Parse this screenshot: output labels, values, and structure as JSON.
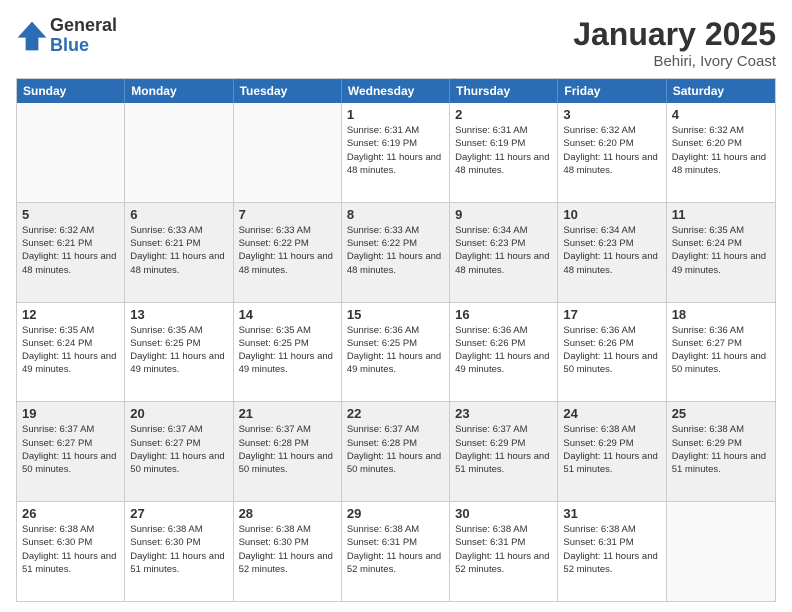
{
  "logo": {
    "general": "General",
    "blue": "Blue"
  },
  "header": {
    "month": "January 2025",
    "location": "Behiri, Ivory Coast"
  },
  "days": [
    "Sunday",
    "Monday",
    "Tuesday",
    "Wednesday",
    "Thursday",
    "Friday",
    "Saturday"
  ],
  "weeks": [
    [
      {
        "day": "",
        "info": ""
      },
      {
        "day": "",
        "info": ""
      },
      {
        "day": "",
        "info": ""
      },
      {
        "day": "1",
        "info": "Sunrise: 6:31 AM\nSunset: 6:19 PM\nDaylight: 11 hours and 48 minutes."
      },
      {
        "day": "2",
        "info": "Sunrise: 6:31 AM\nSunset: 6:19 PM\nDaylight: 11 hours and 48 minutes."
      },
      {
        "day": "3",
        "info": "Sunrise: 6:32 AM\nSunset: 6:20 PM\nDaylight: 11 hours and 48 minutes."
      },
      {
        "day": "4",
        "info": "Sunrise: 6:32 AM\nSunset: 6:20 PM\nDaylight: 11 hours and 48 minutes."
      }
    ],
    [
      {
        "day": "5",
        "info": "Sunrise: 6:32 AM\nSunset: 6:21 PM\nDaylight: 11 hours and 48 minutes."
      },
      {
        "day": "6",
        "info": "Sunrise: 6:33 AM\nSunset: 6:21 PM\nDaylight: 11 hours and 48 minutes."
      },
      {
        "day": "7",
        "info": "Sunrise: 6:33 AM\nSunset: 6:22 PM\nDaylight: 11 hours and 48 minutes."
      },
      {
        "day": "8",
        "info": "Sunrise: 6:33 AM\nSunset: 6:22 PM\nDaylight: 11 hours and 48 minutes."
      },
      {
        "day": "9",
        "info": "Sunrise: 6:34 AM\nSunset: 6:23 PM\nDaylight: 11 hours and 48 minutes."
      },
      {
        "day": "10",
        "info": "Sunrise: 6:34 AM\nSunset: 6:23 PM\nDaylight: 11 hours and 48 minutes."
      },
      {
        "day": "11",
        "info": "Sunrise: 6:35 AM\nSunset: 6:24 PM\nDaylight: 11 hours and 49 minutes."
      }
    ],
    [
      {
        "day": "12",
        "info": "Sunrise: 6:35 AM\nSunset: 6:24 PM\nDaylight: 11 hours and 49 minutes."
      },
      {
        "day": "13",
        "info": "Sunrise: 6:35 AM\nSunset: 6:25 PM\nDaylight: 11 hours and 49 minutes."
      },
      {
        "day": "14",
        "info": "Sunrise: 6:35 AM\nSunset: 6:25 PM\nDaylight: 11 hours and 49 minutes."
      },
      {
        "day": "15",
        "info": "Sunrise: 6:36 AM\nSunset: 6:25 PM\nDaylight: 11 hours and 49 minutes."
      },
      {
        "day": "16",
        "info": "Sunrise: 6:36 AM\nSunset: 6:26 PM\nDaylight: 11 hours and 49 minutes."
      },
      {
        "day": "17",
        "info": "Sunrise: 6:36 AM\nSunset: 6:26 PM\nDaylight: 11 hours and 50 minutes."
      },
      {
        "day": "18",
        "info": "Sunrise: 6:36 AM\nSunset: 6:27 PM\nDaylight: 11 hours and 50 minutes."
      }
    ],
    [
      {
        "day": "19",
        "info": "Sunrise: 6:37 AM\nSunset: 6:27 PM\nDaylight: 11 hours and 50 minutes."
      },
      {
        "day": "20",
        "info": "Sunrise: 6:37 AM\nSunset: 6:27 PM\nDaylight: 11 hours and 50 minutes."
      },
      {
        "day": "21",
        "info": "Sunrise: 6:37 AM\nSunset: 6:28 PM\nDaylight: 11 hours and 50 minutes."
      },
      {
        "day": "22",
        "info": "Sunrise: 6:37 AM\nSunset: 6:28 PM\nDaylight: 11 hours and 50 minutes."
      },
      {
        "day": "23",
        "info": "Sunrise: 6:37 AM\nSunset: 6:29 PM\nDaylight: 11 hours and 51 minutes."
      },
      {
        "day": "24",
        "info": "Sunrise: 6:38 AM\nSunset: 6:29 PM\nDaylight: 11 hours and 51 minutes."
      },
      {
        "day": "25",
        "info": "Sunrise: 6:38 AM\nSunset: 6:29 PM\nDaylight: 11 hours and 51 minutes."
      }
    ],
    [
      {
        "day": "26",
        "info": "Sunrise: 6:38 AM\nSunset: 6:30 PM\nDaylight: 11 hours and 51 minutes."
      },
      {
        "day": "27",
        "info": "Sunrise: 6:38 AM\nSunset: 6:30 PM\nDaylight: 11 hours and 51 minutes."
      },
      {
        "day": "28",
        "info": "Sunrise: 6:38 AM\nSunset: 6:30 PM\nDaylight: 11 hours and 52 minutes."
      },
      {
        "day": "29",
        "info": "Sunrise: 6:38 AM\nSunset: 6:31 PM\nDaylight: 11 hours and 52 minutes."
      },
      {
        "day": "30",
        "info": "Sunrise: 6:38 AM\nSunset: 6:31 PM\nDaylight: 11 hours and 52 minutes."
      },
      {
        "day": "31",
        "info": "Sunrise: 6:38 AM\nSunset: 6:31 PM\nDaylight: 11 hours and 52 minutes."
      },
      {
        "day": "",
        "info": ""
      }
    ]
  ]
}
